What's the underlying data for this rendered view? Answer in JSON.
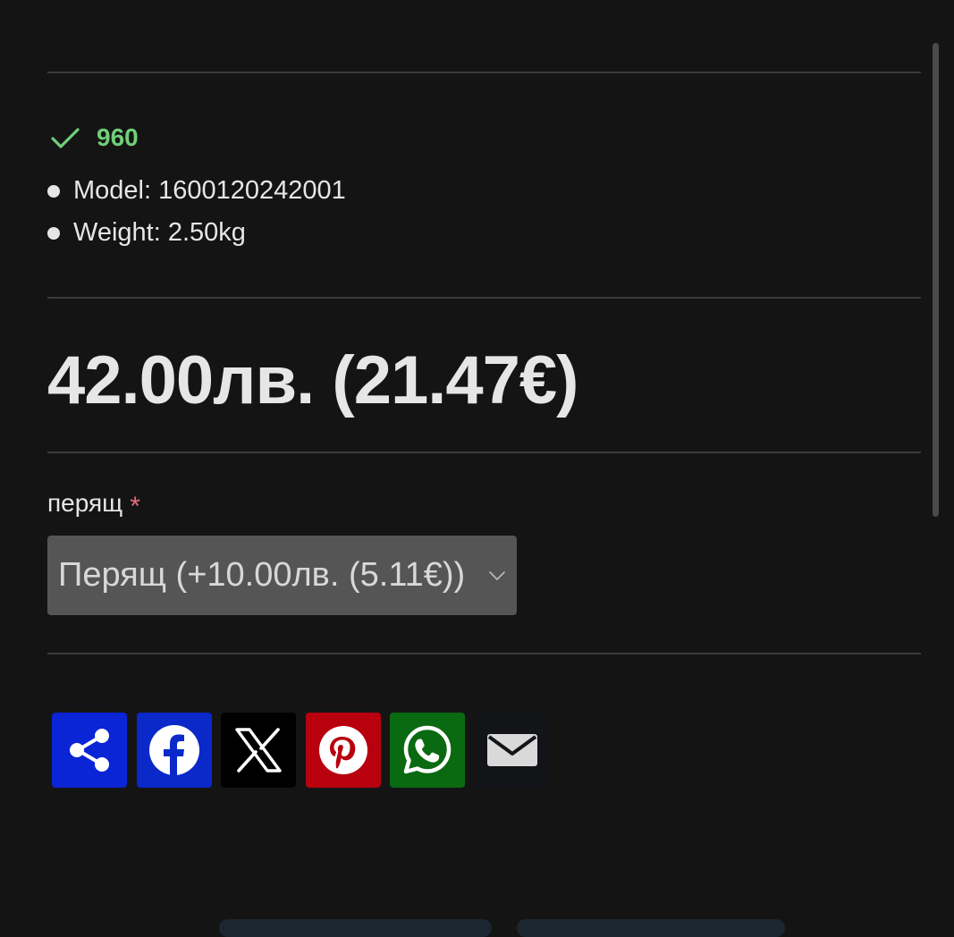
{
  "stock": {
    "count": "960"
  },
  "specs": [
    {
      "text": "Model: 1600120242001"
    },
    {
      "text": "Weight: 2.50kg"
    }
  ],
  "price": {
    "text": "42.00лв. (21.47€)"
  },
  "option": {
    "label": "перящ",
    "required_mark": "*",
    "selected": "Перящ (+10.00лв. (5.11€))"
  },
  "share": {
    "buttons": [
      {
        "name": "share",
        "icon": "share-icon",
        "color": "#0a24d6"
      },
      {
        "name": "facebook",
        "icon": "facebook-icon",
        "color": "#0b28c9"
      },
      {
        "name": "x",
        "icon": "x-icon",
        "color": "#000000"
      },
      {
        "name": "pinterest",
        "icon": "pinterest-icon",
        "color": "#b8000f"
      },
      {
        "name": "whatsapp",
        "icon": "whatsapp-icon",
        "color": "#0a6a12"
      },
      {
        "name": "email",
        "icon": "email-icon",
        "color": "#121418"
      }
    ]
  },
  "colors": {
    "background": "#141414",
    "divider": "#3b3b3b",
    "stock_green": "#6fcf7a",
    "required_red": "#e76b7e",
    "select_bg": "#555555"
  }
}
